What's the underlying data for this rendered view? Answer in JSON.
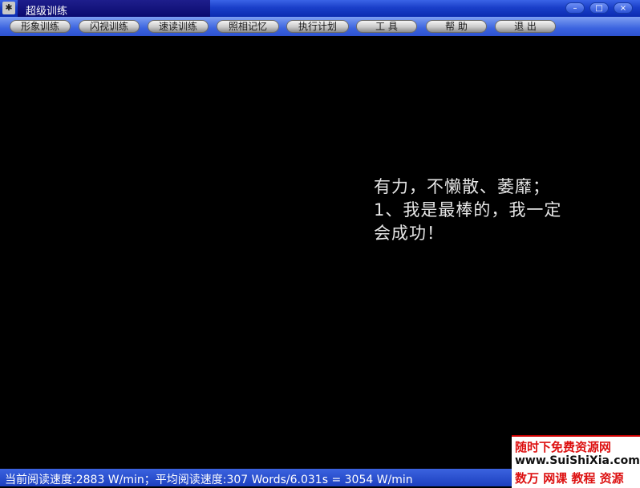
{
  "window": {
    "title": "超级训练",
    "buttons": {
      "minimize": "–",
      "maximize": "□",
      "close": "×"
    }
  },
  "menu": {
    "items": [
      "形象训练",
      "闪视训练",
      "速读训练",
      "照相记忆",
      "执行计划",
      "工 具",
      "帮 助",
      "退 出"
    ]
  },
  "reading": {
    "lines": [
      "有力，不懒散、萎靡；",
      "1、我是最棒的，我一定",
      "会成功！"
    ]
  },
  "status": {
    "text": "当前阅读速度:2883 W/min；平均阅读速度:307 Words/6.031s = 3054 W/min"
  },
  "watermark": {
    "line1": "随时下免费资源网",
    "line2": "www.SuiShiXia.com",
    "line3": "数万 网课 教程 资源"
  },
  "colors": {
    "titlebar": "#1a3fc9",
    "menubar": "#3b63df",
    "background": "#000000",
    "text": "#e6e6e6",
    "watermark_red": "#dd1111"
  }
}
